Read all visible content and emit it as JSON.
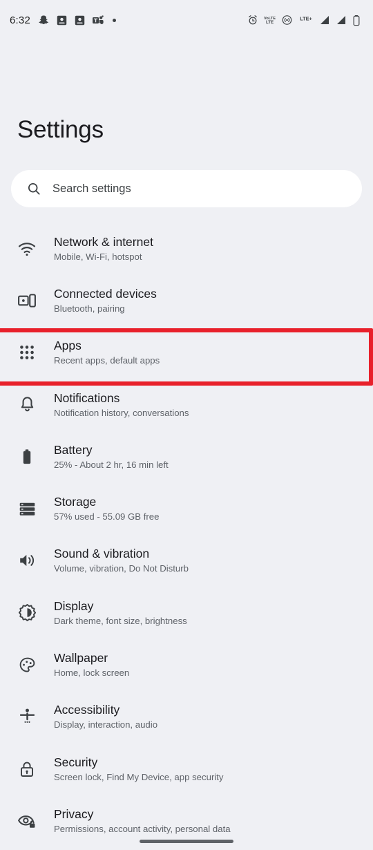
{
  "statusbar": {
    "clock": "6:32",
    "left_icons": [
      {
        "name": "snapchat-icon",
        "label": "Snapchat"
      },
      {
        "name": "screenshot-icon",
        "label": "Screenshot"
      },
      {
        "name": "screenshot-icon-2",
        "label": "Screenshot"
      },
      {
        "name": "teams-icon",
        "label": "Microsoft Teams"
      },
      {
        "name": "more-notifications-dot",
        "label": "More"
      }
    ],
    "right_icons": [
      {
        "name": "alarm-icon",
        "label": "Alarm set"
      },
      {
        "name": "volte-icon",
        "label": "VoLTE"
      },
      {
        "name": "hotspot-icon",
        "label": "Hotspot"
      },
      {
        "name": "network-type-label",
        "label": "LTE+"
      },
      {
        "name": "signal-sim1-icon",
        "label": "Signal SIM 1"
      },
      {
        "name": "signal-sim2-icon",
        "label": "Signal SIM 2"
      },
      {
        "name": "battery-icon",
        "label": "Battery"
      }
    ]
  },
  "header": {
    "title": "Settings"
  },
  "search": {
    "placeholder": "Search settings",
    "value": "",
    "icon": "search-icon"
  },
  "highlight": {
    "color": "#e8202a",
    "target": "apps"
  },
  "colors": {
    "background": "#eff0f4",
    "surface": "#ffffff",
    "title_text": "#1b1b1f",
    "subtitle_text": "#5e6268",
    "icon": "#3c4043",
    "highlight": "#e8202a"
  },
  "settings": {
    "items": [
      {
        "key": "network",
        "icon": "wifi-icon",
        "title": "Network & internet",
        "subtitle": "Mobile, Wi-Fi, hotspot",
        "highlighted": false
      },
      {
        "key": "connected-devices",
        "icon": "connected-devices-icon",
        "title": "Connected devices",
        "subtitle": "Bluetooth, pairing",
        "highlighted": false
      },
      {
        "key": "apps",
        "icon": "apps-grid-icon",
        "title": "Apps",
        "subtitle": "Recent apps, default apps",
        "highlighted": true
      },
      {
        "key": "notifications",
        "icon": "bell-icon",
        "title": "Notifications",
        "subtitle": "Notification history, conversations",
        "highlighted": false
      },
      {
        "key": "battery",
        "icon": "battery-icon",
        "title": "Battery",
        "subtitle": "25% - About 2 hr, 16 min left",
        "highlighted": false
      },
      {
        "key": "storage",
        "icon": "storage-icon",
        "title": "Storage",
        "subtitle": "57% used - 55.09 GB free",
        "highlighted": false
      },
      {
        "key": "sound",
        "icon": "volume-icon",
        "title": "Sound & vibration",
        "subtitle": "Volume, vibration, Do Not Disturb",
        "highlighted": false
      },
      {
        "key": "display",
        "icon": "brightness-icon",
        "title": "Display",
        "subtitle": "Dark theme, font size, brightness",
        "highlighted": false
      },
      {
        "key": "wallpaper",
        "icon": "palette-icon",
        "title": "Wallpaper",
        "subtitle": "Home, lock screen",
        "highlighted": false
      },
      {
        "key": "accessibility",
        "icon": "accessibility-icon",
        "title": "Accessibility",
        "subtitle": "Display, interaction, audio",
        "highlighted": false
      },
      {
        "key": "security",
        "icon": "lock-icon",
        "title": "Security",
        "subtitle": "Screen lock, Find My Device, app security",
        "highlighted": false
      },
      {
        "key": "privacy",
        "icon": "eye-lock-icon",
        "title": "Privacy",
        "subtitle": "Permissions, account activity, personal data",
        "highlighted": false
      }
    ]
  },
  "navigation": {
    "home_indicator": "home-indicator"
  }
}
